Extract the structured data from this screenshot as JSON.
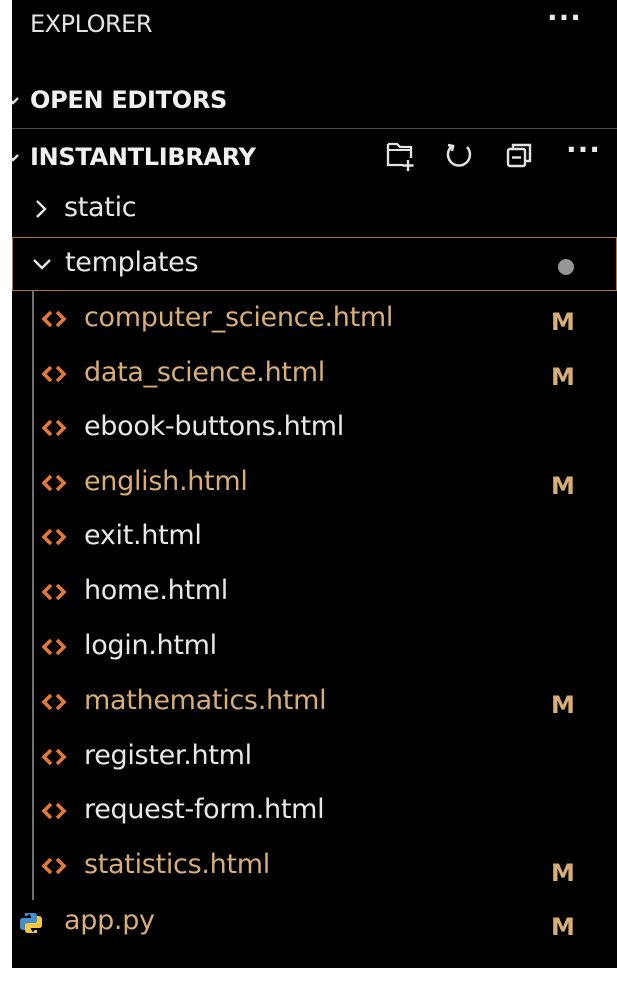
{
  "explorer": {
    "title": "EXPLORER",
    "more_icon": "ellipsis-icon"
  },
  "sections": {
    "open_editors": "OPEN EDITORS",
    "workspace": "INSTANTLIBRARY"
  },
  "workspace_actions": {
    "new_file_icon": "new-file-icon",
    "refresh_icon": "refresh-icon",
    "collapse_icon": "collapse-folders-icon",
    "more_icon": "ellipsis-icon"
  },
  "tree": {
    "folders": [
      {
        "name": "static",
        "expanded": false
      },
      {
        "name": "templates",
        "expanded": true,
        "status": "modified-dot"
      }
    ],
    "template_files": [
      {
        "name": "computer_science.html",
        "badge": "M",
        "modified": true
      },
      {
        "name": "data_science.html",
        "badge": "M",
        "modified": true
      },
      {
        "name": "ebook-buttons.html",
        "badge": "",
        "modified": false
      },
      {
        "name": "english.html",
        "badge": "M",
        "modified": true
      },
      {
        "name": "exit.html",
        "badge": "",
        "modified": false
      },
      {
        "name": "home.html",
        "badge": "",
        "modified": false
      },
      {
        "name": "login.html",
        "badge": "",
        "modified": false
      },
      {
        "name": "mathematics.html",
        "badge": "M",
        "modified": true
      },
      {
        "name": "register.html",
        "badge": "",
        "modified": false
      },
      {
        "name": "request-form.html",
        "badge": "",
        "modified": false
      },
      {
        "name": "statistics.html",
        "badge": "M",
        "modified": true
      }
    ],
    "root_file": {
      "name": "app.py",
      "badge": "M",
      "modified": true
    }
  },
  "colors": {
    "background": "#000000",
    "text": "#e8e8e8",
    "modified": "#d7ad78",
    "html_icon": "#e37933",
    "folder_focus_border": "#b27a32",
    "python_blue": "#3f8fd1",
    "python_yellow": "#f5c842"
  }
}
